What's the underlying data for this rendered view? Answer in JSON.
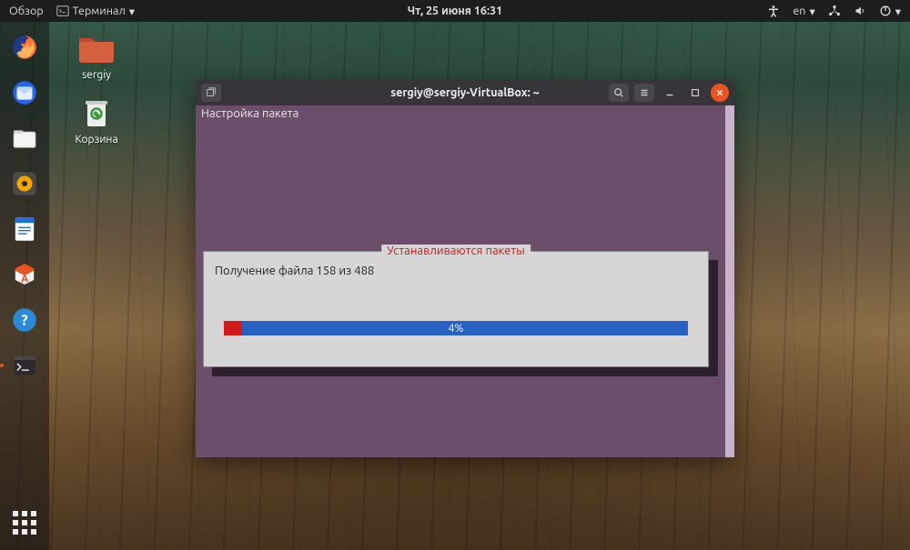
{
  "topbar": {
    "activities": "Обзор",
    "app_menu": "Терминал",
    "datetime": "Чт, 25 июня  16:31",
    "lang": "en"
  },
  "desktop": {
    "home_label": "sergiy",
    "trash_label": "Корзина"
  },
  "dock": {
    "items": [
      {
        "name": "firefox"
      },
      {
        "name": "thunderbird"
      },
      {
        "name": "files"
      },
      {
        "name": "rhythmbox"
      },
      {
        "name": "libreoffice-writer"
      },
      {
        "name": "software"
      },
      {
        "name": "help"
      },
      {
        "name": "terminal"
      }
    ]
  },
  "window": {
    "title": "sergiy@sergiy-VirtualBox: ~"
  },
  "terminal": {
    "header": "Настройка пакета",
    "dialog_title": "Устанавливаются пакеты",
    "progress_text": "Получение файла 158 из 488",
    "progress_percent": 4,
    "progress_label": "4%"
  },
  "colors": {
    "ubuntu_orange": "#e95420",
    "dialog_bg": "#d6d6d6",
    "dialog_title_red": "#c61b1b",
    "progress_blue": "#2860c4",
    "progress_red": "#d21c1c",
    "term_bg": "#6a4e6a"
  }
}
